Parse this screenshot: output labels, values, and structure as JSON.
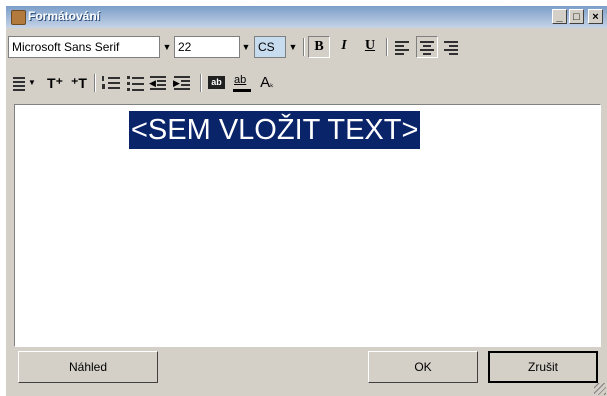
{
  "window": {
    "title": "Formátování"
  },
  "titlebar_buttons": {
    "minimize": "_",
    "maximize": "□",
    "close": "×"
  },
  "toolbar": {
    "font_name": "Microsoft Sans Serif",
    "font_size": "22",
    "charset": "CS",
    "bold_label": "B",
    "italic_label": "I",
    "underline_label": "U"
  },
  "editor": {
    "content": "<SEM VLOŽIT TEXT>"
  },
  "buttons": {
    "preview": "Náhled",
    "ok": "OK",
    "cancel": "Zrušit"
  },
  "colors": {
    "title_bar": "#7b9ec9",
    "selection": "#0a246a",
    "window": "#d4d0c8"
  },
  "icons": [
    "align-left-icon",
    "align-center-icon",
    "align-right-icon",
    "bullets-dropdown-icon",
    "increase-font-icon",
    "decrease-font-icon",
    "numbered-list-icon",
    "bullet-list-icon",
    "decrease-indent-icon",
    "increase-indent-icon",
    "background-color-icon",
    "text-color-icon",
    "clear-format-icon"
  ]
}
